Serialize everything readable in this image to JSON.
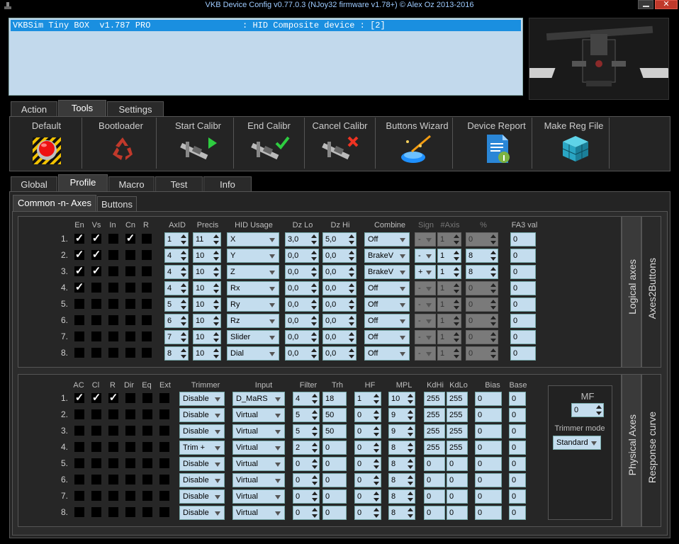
{
  "window": {
    "title": "VKB Device Config v0.77.0.3 (NJoy32 firmware v1.78+) © Alex Oz 2013-2016",
    "close": "✕"
  },
  "device_list": {
    "row": "VKBSim Tiny BOX  v1.787 PRO                  : HID Composite device : [2]"
  },
  "main_tabs": [
    "Action",
    "Tools",
    "Settings"
  ],
  "tools": [
    "Default",
    "Bootloader",
    "Start Calibr",
    "End Calibr",
    "Cancel Calibr",
    "Buttons Wizard",
    "Device Report",
    "Make Reg File"
  ],
  "profile_tabs": [
    "Global",
    "Profile",
    "Macro",
    "Test",
    "Info"
  ],
  "sub_tabs": [
    "Common -n- Axes",
    "Buttons"
  ],
  "logical": {
    "headers": {
      "en": "En",
      "vs": "Vs",
      "in": "In",
      "cn": "Cn",
      "r": "R",
      "axid": "AxID",
      "precis": "Precis",
      "hid": "HID Usage",
      "dzlo": "Dz Lo",
      "dzhi": "Dz Hi",
      "combine": "Combine",
      "sign": "Sign",
      "naxis": "#Axis",
      "pct": "%",
      "fa3": "FA3 val"
    },
    "rows": [
      {
        "n": "1.",
        "en": true,
        "vs": true,
        "in": false,
        "cn": true,
        "r": false,
        "axid": "1",
        "precis": "11",
        "hid": "X",
        "dzlo": "3,0",
        "dzhi": "5,0",
        "combine": "Off",
        "sign": "-",
        "naxis": "1",
        "pct": "0",
        "fa3": "0",
        "sign_on": false
      },
      {
        "n": "2.",
        "en": true,
        "vs": true,
        "in": false,
        "cn": false,
        "r": false,
        "axid": "4",
        "precis": "10",
        "hid": "Y",
        "dzlo": "0,0",
        "dzhi": "0,0",
        "combine": "BrakeV",
        "sign": "-",
        "naxis": "1",
        "pct": "8",
        "fa3": "0",
        "sign_on": true
      },
      {
        "n": "3.",
        "en": true,
        "vs": true,
        "in": false,
        "cn": false,
        "r": false,
        "axid": "4",
        "precis": "10",
        "hid": "Z",
        "dzlo": "0,0",
        "dzhi": "0,0",
        "combine": "BrakeV",
        "sign": "+",
        "naxis": "1",
        "pct": "8",
        "fa3": "0",
        "sign_on": true
      },
      {
        "n": "4.",
        "en": true,
        "vs": false,
        "in": false,
        "cn": false,
        "r": false,
        "axid": "4",
        "precis": "10",
        "hid": "Rx",
        "dzlo": "0,0",
        "dzhi": "0,0",
        "combine": "Off",
        "sign": "-",
        "naxis": "1",
        "pct": "0",
        "fa3": "0",
        "sign_on": false
      },
      {
        "n": "5.",
        "en": false,
        "vs": false,
        "in": false,
        "cn": false,
        "r": false,
        "axid": "5",
        "precis": "10",
        "hid": "Ry",
        "dzlo": "0,0",
        "dzhi": "0,0",
        "combine": "Off",
        "sign": "-",
        "naxis": "1",
        "pct": "0",
        "fa3": "0",
        "sign_on": false
      },
      {
        "n": "6.",
        "en": false,
        "vs": false,
        "in": false,
        "cn": false,
        "r": false,
        "axid": "6",
        "precis": "10",
        "hid": "Rz",
        "dzlo": "0,0",
        "dzhi": "0,0",
        "combine": "Off",
        "sign": "-",
        "naxis": "1",
        "pct": "0",
        "fa3": "0",
        "sign_on": false
      },
      {
        "n": "7.",
        "en": false,
        "vs": false,
        "in": false,
        "cn": false,
        "r": false,
        "axid": "7",
        "precis": "10",
        "hid": "Slider",
        "dzlo": "0,0",
        "dzhi": "0,0",
        "combine": "Off",
        "sign": "-",
        "naxis": "1",
        "pct": "0",
        "fa3": "0",
        "sign_on": false
      },
      {
        "n": "8.",
        "en": false,
        "vs": false,
        "in": false,
        "cn": false,
        "r": false,
        "axid": "8",
        "precis": "10",
        "hid": "Dial",
        "dzlo": "0,0",
        "dzhi": "0,0",
        "combine": "Off",
        "sign": "-",
        "naxis": "1",
        "pct": "0",
        "fa3": "0",
        "sign_on": false
      }
    ],
    "side_tabs": [
      "Logical axes",
      "Axes2Buttons"
    ]
  },
  "physical": {
    "headers": {
      "ac": "AC",
      "cl": "Cl",
      "r": "R",
      "dir": "Dir",
      "eq": "Eq",
      "ext": "Ext",
      "trimmer": "Trimmer",
      "input": "Input",
      "filter": "Filter",
      "trh": "Trh",
      "hf": "HF",
      "mpl": "MPL",
      "kdhi": "KdHi",
      "kdlo": "KdLo",
      "bias": "Bias",
      "base": "Base"
    },
    "rows": [
      {
        "n": "1.",
        "ac": true,
        "cl": true,
        "r": true,
        "trimmer": "Disable",
        "input": "D_MaRS",
        "filter": "4",
        "trh": "18",
        "hf": "1",
        "mpl": "10",
        "kdhi": "255",
        "kdlo": "255",
        "bias": "0",
        "base": "0"
      },
      {
        "n": "2.",
        "ac": false,
        "cl": false,
        "r": false,
        "trimmer": "Disable",
        "input": "Virtual",
        "filter": "5",
        "trh": "50",
        "hf": "0",
        "mpl": "9",
        "kdhi": "255",
        "kdlo": "255",
        "bias": "0",
        "base": "0"
      },
      {
        "n": "3.",
        "ac": false,
        "cl": false,
        "r": false,
        "trimmer": "Disable",
        "input": "Virtual",
        "filter": "5",
        "trh": "50",
        "hf": "0",
        "mpl": "9",
        "kdhi": "255",
        "kdlo": "255",
        "bias": "0",
        "base": "0"
      },
      {
        "n": "4.",
        "ac": false,
        "cl": false,
        "r": false,
        "trimmer": "Trim +",
        "input": "Virtual",
        "filter": "2",
        "trh": "0",
        "hf": "0",
        "mpl": "8",
        "kdhi": "255",
        "kdlo": "255",
        "bias": "0",
        "base": "0"
      },
      {
        "n": "5.",
        "ac": false,
        "cl": false,
        "r": false,
        "trimmer": "Disable",
        "input": "Virtual",
        "filter": "0",
        "trh": "0",
        "hf": "0",
        "mpl": "8",
        "kdhi": "0",
        "kdlo": "0",
        "bias": "0",
        "base": "0"
      },
      {
        "n": "6.",
        "ac": false,
        "cl": false,
        "r": false,
        "trimmer": "Disable",
        "input": "Virtual",
        "filter": "0",
        "trh": "0",
        "hf": "0",
        "mpl": "8",
        "kdhi": "0",
        "kdlo": "0",
        "bias": "0",
        "base": "0"
      },
      {
        "n": "7.",
        "ac": false,
        "cl": false,
        "r": false,
        "trimmer": "Disable",
        "input": "Virtual",
        "filter": "0",
        "trh": "0",
        "hf": "0",
        "mpl": "8",
        "kdhi": "0",
        "kdlo": "0",
        "bias": "0",
        "base": "0"
      },
      {
        "n": "8.",
        "ac": false,
        "cl": false,
        "r": false,
        "trimmer": "Disable",
        "input": "Virtual",
        "filter": "0",
        "trh": "0",
        "hf": "0",
        "mpl": "8",
        "kdhi": "0",
        "kdlo": "0",
        "bias": "0",
        "base": "0"
      }
    ],
    "mf": {
      "label": "MF",
      "value": "0",
      "trimmer_mode_label": "Trimmer mode",
      "trimmer_mode": "Standard"
    },
    "side_tabs": [
      "Physical Axes",
      "Response curve"
    ]
  },
  "icons": [
    "app-icon",
    "default-icon",
    "bootloader-icon",
    "start-calibr-icon",
    "end-calibr-icon",
    "cancel-calibr-icon",
    "buttons-wizard-icon",
    "device-report-icon",
    "make-reg-file-icon"
  ]
}
